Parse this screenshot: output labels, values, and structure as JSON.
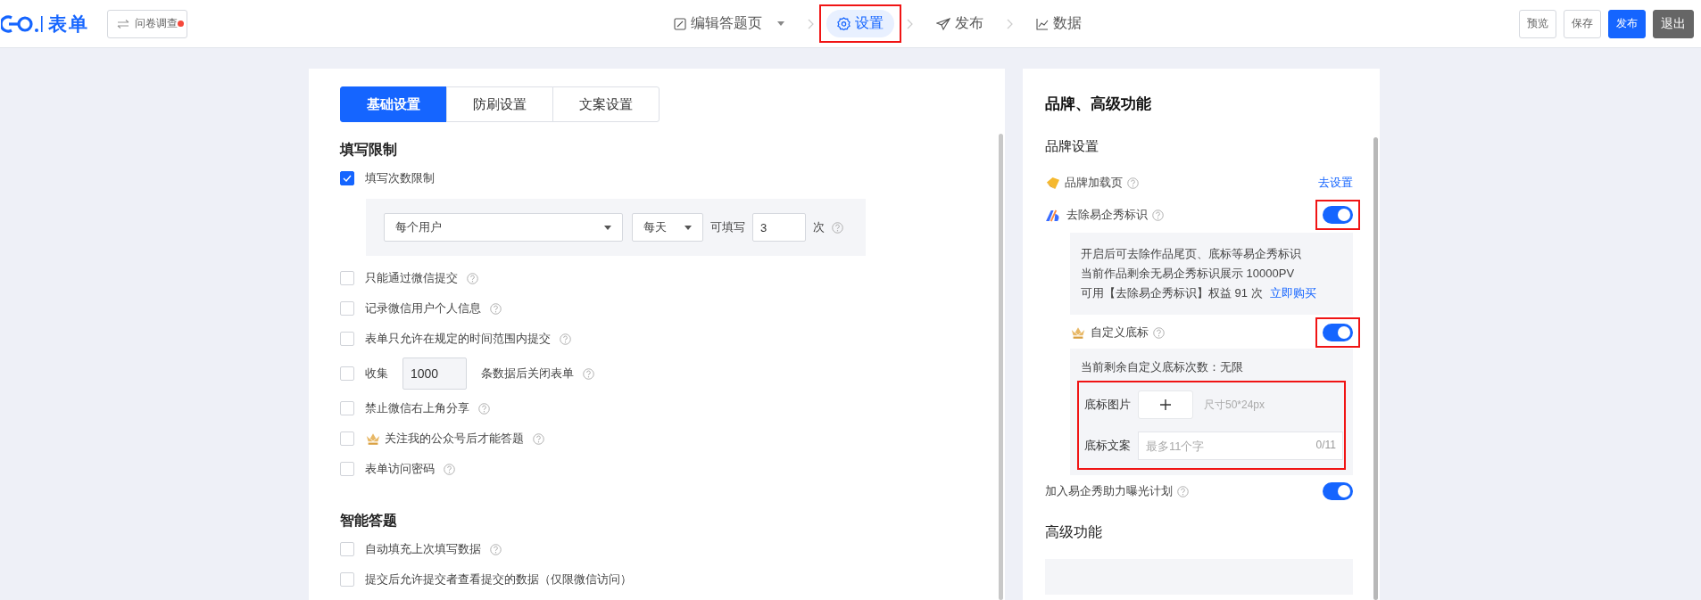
{
  "header": {
    "logo_text": "表单",
    "type_button": {
      "label": "问卷调查",
      "notification": true
    },
    "steps": [
      {
        "label": "编辑答题页",
        "dropdown": true,
        "selected": false,
        "highlighted": false
      },
      {
        "label": "设置",
        "dropdown": false,
        "selected": true,
        "highlighted": true
      },
      {
        "label": "发布",
        "dropdown": false,
        "selected": false,
        "highlighted": false
      },
      {
        "label": "数据",
        "dropdown": false,
        "selected": false,
        "highlighted": false
      }
    ],
    "actions": [
      {
        "label": "预览",
        "kind": "default"
      },
      {
        "label": "保存",
        "kind": "default"
      },
      {
        "label": "发布",
        "kind": "primary"
      },
      {
        "label": "退出",
        "kind": "dark"
      }
    ]
  },
  "left": {
    "tabs": [
      {
        "label": "基础设置",
        "selected": true
      },
      {
        "label": "防刷设置",
        "selected": false
      },
      {
        "label": "文案设置",
        "selected": false
      }
    ],
    "sections": [
      {
        "title": "填写限制",
        "items": [
          {
            "kind": "checkbox",
            "label": "填写次数限制",
            "checked": true,
            "help": false,
            "premium": false
          },
          {
            "kind": "limit",
            "user_select": "每个用户",
            "period_select": "每天",
            "count_label": "可填写",
            "count": "3",
            "unit": "次",
            "help": true
          },
          {
            "kind": "checkbox",
            "label": "只能通过微信提交",
            "checked": false,
            "help": true,
            "premium": false
          },
          {
            "kind": "checkbox",
            "label": "记录微信用户个人信息",
            "checked": false,
            "help": true,
            "premium": false
          },
          {
            "kind": "checkbox",
            "label": "表单只允许在规定的时间范围内提交",
            "checked": false,
            "help": true,
            "premium": false
          },
          {
            "kind": "collect",
            "prefix": "收集",
            "value": "1000",
            "suffix": "条数据后关闭表单",
            "checked": false,
            "help": true
          },
          {
            "kind": "checkbox",
            "label": "禁止微信右上角分享",
            "checked": false,
            "help": true,
            "premium": false
          },
          {
            "kind": "checkbox",
            "label": "关注我的公众号后才能答题",
            "checked": false,
            "help": true,
            "premium": true
          },
          {
            "kind": "checkbox",
            "label": "表单访问密码",
            "checked": false,
            "help": true,
            "premium": false
          }
        ]
      },
      {
        "title": "智能答题",
        "items": [
          {
            "kind": "checkbox",
            "label": "自动填充上次填写数据",
            "checked": false,
            "help": true,
            "premium": false
          },
          {
            "kind": "checkbox",
            "label": "提交后允许提交者查看提交的数据（仅限微信访问）",
            "checked": false,
            "help": false,
            "premium": false
          }
        ]
      }
    ]
  },
  "right": {
    "title": "品牌、高级功能",
    "brand_title": "品牌设置",
    "rows": [
      {
        "kind": "link",
        "label": "品牌加载页",
        "help": true,
        "link": "去设置"
      },
      {
        "kind": "toggle",
        "label": "去除易企秀标识",
        "help": true,
        "on": true,
        "highlighted": true,
        "detail": {
          "lines": [
            "开启后可去除作品尾页、底标等易企秀标识",
            "当前作品剩余无易企秀标识展示 10000PV",
            "可用【去除易企秀标识】权益 91 次"
          ],
          "link": "立即购买"
        },
        "sub": {
          "label": "自定义底标",
          "help": true,
          "on": true,
          "highlighted": true,
          "remaining": "当前剩余自定义底标次数：无限",
          "form": {
            "highlighted": true,
            "image_label": "底标图片",
            "image_hint": "尺寸50*24px",
            "text_label": "底标文案",
            "placeholder": "最多11个字",
            "counter": "0/11"
          }
        }
      },
      {
        "kind": "toggle",
        "label": "加入易企秀助力曝光计划",
        "help": true,
        "on": true,
        "highlighted": false
      }
    ],
    "advanced_title": "高级功能"
  }
}
